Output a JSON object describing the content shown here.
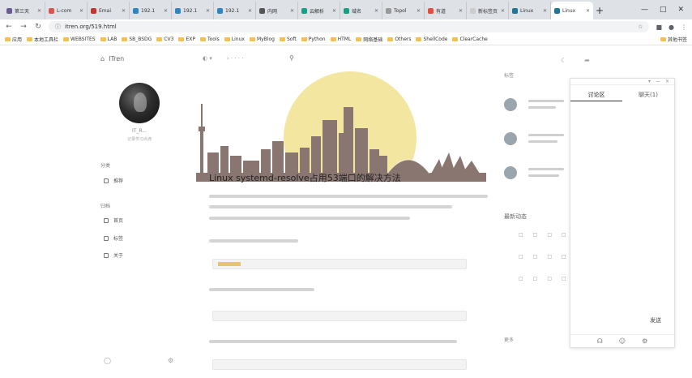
{
  "browser": {
    "tabs": [
      {
        "label": "第三天",
        "color": "#6b5b95"
      },
      {
        "label": "L-com",
        "color": "#d9534f"
      },
      {
        "label": "Emai",
        "color": "#c0392b"
      },
      {
        "label": "192.1",
        "color": "#2e86c1"
      },
      {
        "label": "192.1",
        "color": "#2e86c1"
      },
      {
        "label": "192.1",
        "color": "#2e86c1"
      },
      {
        "label": "内网",
        "color": "#555555"
      },
      {
        "label": "云解析",
        "color": "#16a085"
      },
      {
        "label": "域名",
        "color": "#16a085"
      },
      {
        "label": "Topol",
        "color": "#999999"
      },
      {
        "label": "有道",
        "color": "#e74c3c"
      },
      {
        "label": "新标签页",
        "color": "#cccccc"
      },
      {
        "label": "Linux",
        "color": "#21759b"
      },
      {
        "label": "Linux",
        "color": "#21759b",
        "active": true
      }
    ],
    "new_tab": "+",
    "url": "itren.org/519.html",
    "bookmarks": [
      "应用",
      "本地工具栏",
      "WEBSITES",
      "LAB",
      "SB_BSDG",
      "CV3",
      "EXP",
      "Tools",
      "Linux",
      "MyBlog",
      "Soft",
      "Python",
      "HTML",
      "网络基础",
      "Others",
      "ShellCode",
      "ClearCache"
    ],
    "bookmarks_right": "其他书签"
  },
  "site": {
    "brand": "ITren",
    "search_icon": "search-icon",
    "author_name": "IT_R...",
    "author_sub": "记录学习点滴",
    "nav_section_1": "分类",
    "nav_section_2": "归档",
    "nav_items": [
      "推荐",
      "首页",
      "标签",
      "关于"
    ]
  },
  "article": {
    "title": "Linux systemd-resolve占用53端口的解决方法"
  },
  "right": {
    "panel_tab_1": "讨论区",
    "panel_tab_2": "聊天(1)",
    "send": "发送",
    "status_title": "最新动态",
    "side_label_1": "标签",
    "side_label_2": "更多"
  }
}
